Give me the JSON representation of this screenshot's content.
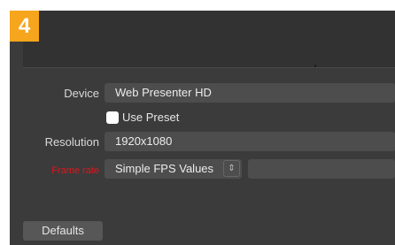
{
  "step": {
    "number": "4"
  },
  "form": {
    "device": {
      "label": "Device",
      "value": "Web Presenter HD"
    },
    "use_preset": {
      "label": "Use Preset",
      "checked": false
    },
    "resolution": {
      "label": "Resolution",
      "value": "1920x1080"
    },
    "frame_rate": {
      "label": "Frame rate",
      "value": "Simple FPS Values",
      "second_value": ""
    }
  },
  "buttons": {
    "defaults": "Defaults"
  },
  "colors": {
    "badge": "#f6a51c",
    "panel": "#3b3b3b",
    "field": "#4d4d4d",
    "warning_label": "#e0151d"
  },
  "icons": {
    "stepper": "chevron-up-down-icon"
  }
}
